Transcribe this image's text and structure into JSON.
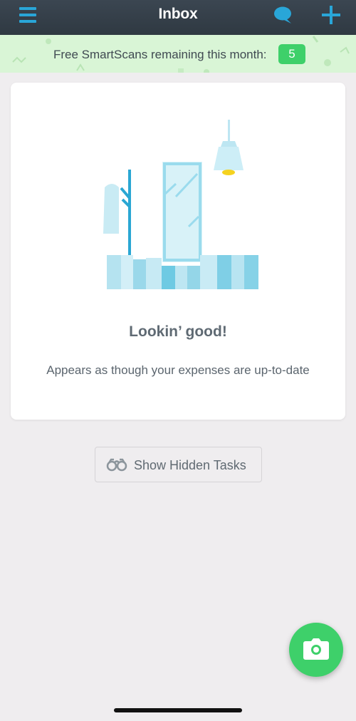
{
  "header": {
    "title": "Inbox",
    "menu_icon": "hamburger-menu-icon",
    "chat_icon": "chat-bubble-icon",
    "add_icon": "plus-icon",
    "accent_color": "#29a6d8"
  },
  "banner": {
    "text": "Free SmartScans remaining this month:",
    "count": "5",
    "badge_color": "#3ed06a"
  },
  "empty_state": {
    "heading": "Lookin’ good!",
    "message": "Appears as though your expenses are up-to-date",
    "illustration": "coat-rack-mirror-lamp-illustration"
  },
  "hidden_tasks": {
    "label": "Show Hidden Tasks",
    "icon": "binoculars-icon"
  },
  "fab": {
    "icon": "camera-icon",
    "color": "#3ed06a"
  }
}
